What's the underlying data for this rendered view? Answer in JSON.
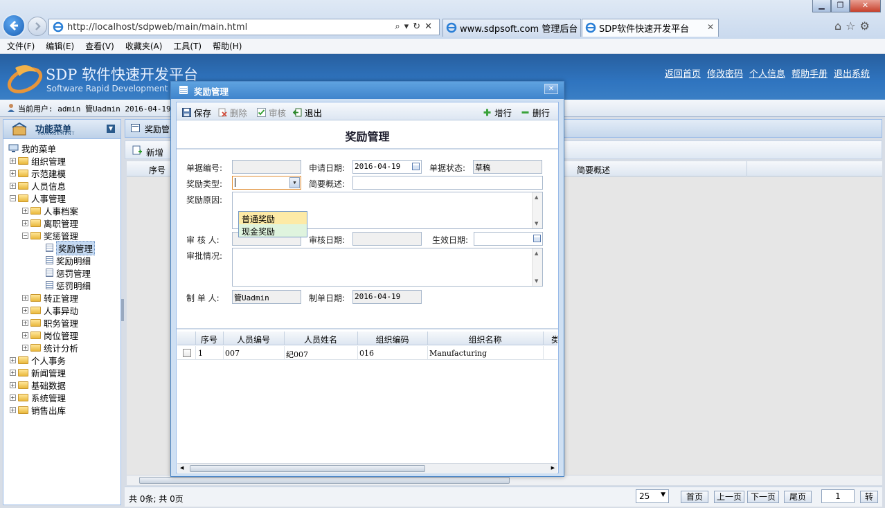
{
  "browser": {
    "url": "http://localhost/sdpweb/main/main.html",
    "tabs": [
      {
        "label": "www.sdpsoft.com 管理后台"
      },
      {
        "label": "SDP软件快速开发平台"
      }
    ],
    "menu": [
      "文件(F)",
      "编辑(E)",
      "查看(V)",
      "收藏夹(A)",
      "工具(T)",
      "帮助(H)"
    ]
  },
  "header": {
    "title": "SDP 软件快速开发平台",
    "subtitle": "Software Rapid Development P",
    "links": [
      "返回首页",
      "修改密码",
      "个人信息",
      "帮助手册",
      "退出系统"
    ]
  },
  "userbar": {
    "text": "当前用户: admin 管Uadmin 2016-04-19"
  },
  "sidebar": {
    "title": "功能菜单",
    "subtitle": "MANAGEMENT",
    "root": "我的菜单",
    "items": [
      {
        "label": "组织管理"
      },
      {
        "label": "示范建模"
      },
      {
        "label": "人员信息"
      },
      {
        "label": "人事管理"
      },
      {
        "label": "人事档案"
      },
      {
        "label": "离职管理"
      },
      {
        "label": "奖惩管理"
      },
      {
        "label": "奖励管理"
      },
      {
        "label": "奖励明细"
      },
      {
        "label": "惩罚管理"
      },
      {
        "label": "惩罚明细"
      },
      {
        "label": "转正管理"
      },
      {
        "label": "人事异动"
      },
      {
        "label": "职务管理"
      },
      {
        "label": "岗位管理"
      },
      {
        "label": "统计分析"
      },
      {
        "label": "个人事务"
      },
      {
        "label": "新闻管理"
      },
      {
        "label": "基础数据"
      },
      {
        "label": "系统管理"
      },
      {
        "label": "销售出库"
      }
    ]
  },
  "main": {
    "tab": "奖励管",
    "toolbar_new": "新增",
    "columns": [
      "序号",
      "简要概述"
    ],
    "pager": {
      "info": "共 0条; 共 0页",
      "page_size": "25",
      "buttons": [
        "首页",
        "上一页",
        "下一页",
        "尾页"
      ],
      "page": "1",
      "go": "转"
    }
  },
  "dialog": {
    "title": "奖励管理",
    "form_title": "奖励管理",
    "toolbar": {
      "save": "保存",
      "delete": "删除",
      "audit": "审核",
      "exit": "退出",
      "add_row": "增行",
      "del_row": "删行"
    },
    "labels": {
      "doc_no": "单据编号:",
      "apply_date": "申请日期:",
      "doc_status": "单据状态:",
      "reward_type": "奖励类型:",
      "summary": "简要概述:",
      "reason": "奖励原因:",
      "auditor": "审 核 人:",
      "audit_date": "审核日期:",
      "effective_date": "生效日期:",
      "approval": "审批情况:",
      "maker": "制 单 人:",
      "make_date": "制单日期:"
    },
    "values": {
      "doc_no": "",
      "apply_date": "2016-04-19",
      "doc_status": "草稿",
      "reward_type": "",
      "summary": "",
      "auditor": "",
      "audit_date": "",
      "effective_date": "",
      "maker": "管Uadmin",
      "make_date": "2016-04-19"
    },
    "dropdown_options": [
      "普通奖励",
      "现金奖励"
    ],
    "grid": {
      "columns": [
        "序号",
        "人员编号",
        "人员姓名",
        "组织编码",
        "组织名称",
        "类"
      ],
      "rows": [
        {
          "no": "1",
          "emp_code": "007",
          "emp_name": "纪007",
          "org_code": "016",
          "org_name": "Manufacturing"
        }
      ]
    }
  }
}
